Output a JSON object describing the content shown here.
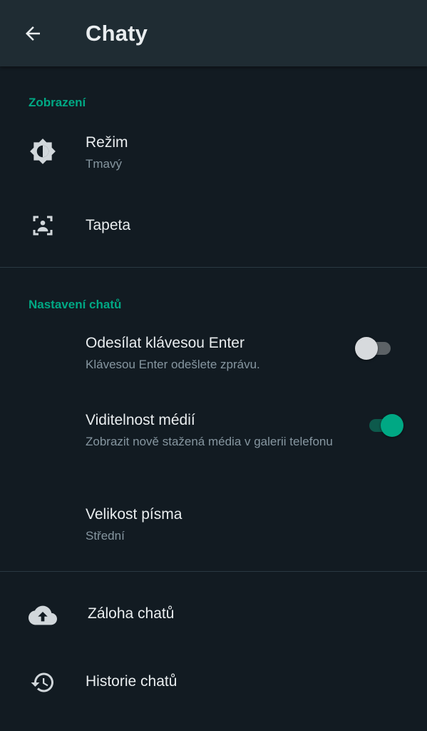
{
  "appbar": {
    "title": "Chaty",
    "back_icon": "arrow-left-icon"
  },
  "sections": {
    "display": {
      "header": "Zobrazení"
    },
    "chat_settings": {
      "header": "Nastavení chatů"
    }
  },
  "items": {
    "theme": {
      "icon": "brightness-icon",
      "title": "Režim",
      "subtitle": "Tmavý"
    },
    "wallpaper": {
      "icon": "wallpaper-icon",
      "title": "Tapeta"
    },
    "enter_send": {
      "title": "Odesílat klávesou Enter",
      "subtitle": "Klávesou Enter odešlete zprávu.",
      "enabled": false
    },
    "media_visibility": {
      "title": "Viditelnost médií",
      "subtitle": "Zobrazit nově stažená média v galerii telefonu",
      "enabled": true
    },
    "font_size": {
      "title": "Velikost písma",
      "subtitle": "Střední"
    },
    "backup": {
      "icon": "cloud-upload-icon",
      "title": "Záloha chatů"
    },
    "history": {
      "icon": "history-icon",
      "title": "Historie chatů"
    }
  },
  "colors": {
    "accent": "#00a884",
    "background": "#121b22",
    "appbar": "#1f2c33",
    "primary_text": "#e9edef",
    "secondary_text": "#8696a0"
  }
}
